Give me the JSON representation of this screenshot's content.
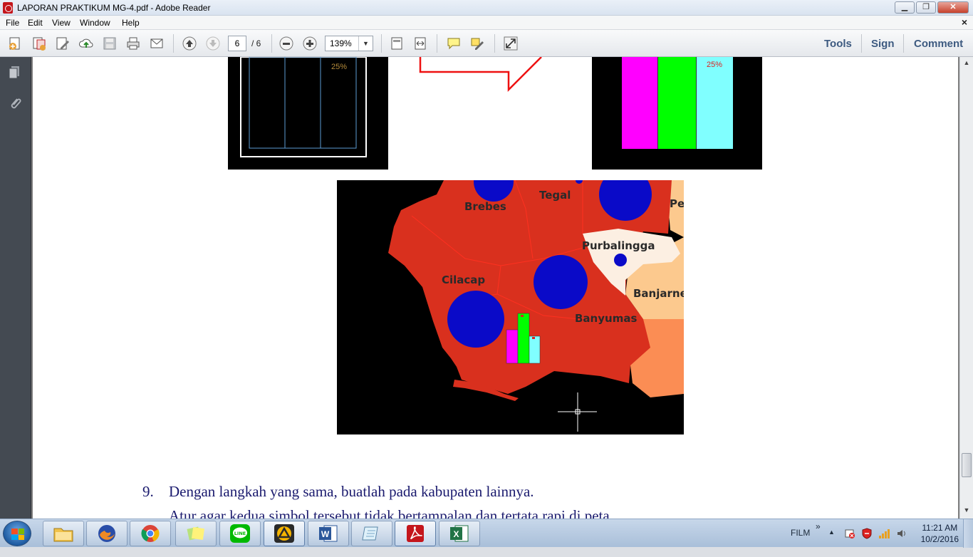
{
  "window": {
    "title": "LAPORAN PRAKTIKUM MG-4.pdf - Adobe Reader",
    "minimize": "▁",
    "restore": "❐",
    "close": "✕"
  },
  "menu": {
    "items": [
      "File",
      "Edit",
      "View",
      "Window",
      "Help"
    ],
    "close_doc": "×"
  },
  "toolbar": {
    "page_current": "6",
    "page_total": "/ 6",
    "zoom": "139%",
    "zoom_dropdown": "▼",
    "tools": "Tools",
    "sign": "Sign",
    "comment": "Comment"
  },
  "document": {
    "fig_left_label": "25%",
    "fig_right_label": "25%",
    "map_labels": {
      "brebes": "Brebes",
      "tegal": "Tegal",
      "pe": "Pe",
      "purbalingga": "Purbalingga",
      "cilacap": "Cilacap",
      "banjarne": "Banjarne",
      "banyumas": "Banyumas"
    },
    "paragraph_number": "9.",
    "paragraph_line1": "Dengan langkah yang sama, buatlah pada kabupaten lainnya.",
    "paragraph_line2": "Atur agar kedua simbol tersebut tidak bertampalan dan tertata rapi di peta."
  },
  "colors": {
    "map_region": "#d9301e",
    "symbol_circle": "#0a0ac8",
    "bar_magenta": "#ff00ff",
    "bar_green": "#00ff00",
    "bar_cyan": "#80ffff",
    "doc_text": "#1a1a6e",
    "pale_region": "#fcefe2",
    "tan_region": "#fcc98e",
    "orange_region": "#fb8d54"
  },
  "taskbar": {
    "apps": [
      "windows-explorer",
      "firefox",
      "chrome",
      "sticky-notes",
      "line",
      "archicad",
      "word",
      "notes-app",
      "adobe-reader",
      "excel"
    ],
    "tray_label": "FILM",
    "tray_expand": "»",
    "tray_arrow": "▲",
    "time": "11:21 AM",
    "date": "10/2/2016"
  }
}
